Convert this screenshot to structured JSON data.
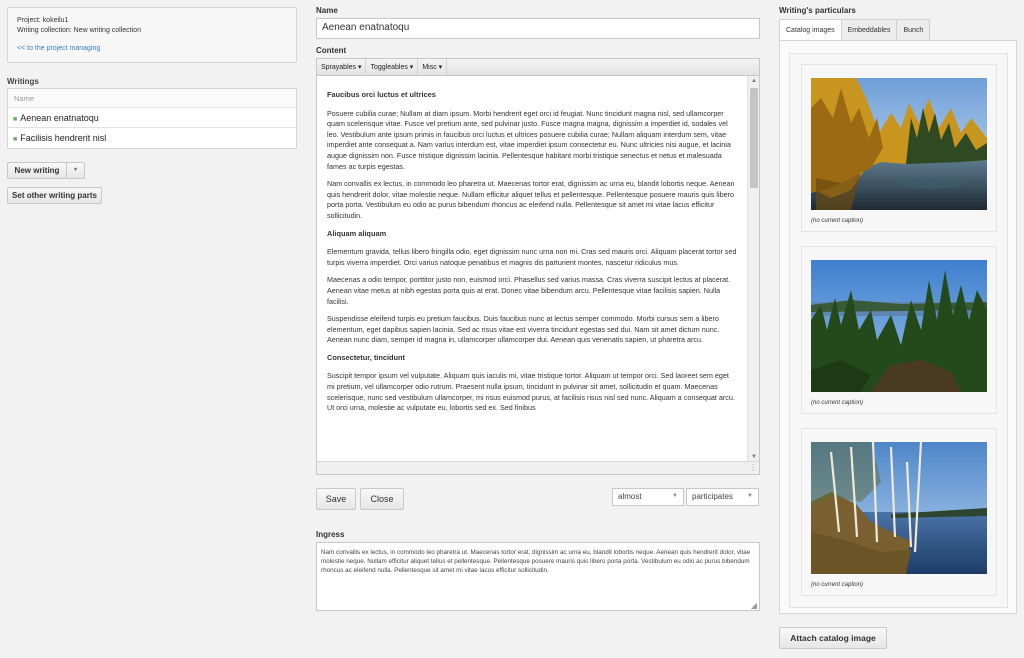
{
  "project": {
    "project_line": "Project: kokeilu1",
    "collection_line": "Writing collection: New writing collection",
    "managing_link": "<< to the project managing"
  },
  "writings": {
    "label": "Writings",
    "column_header": "Name",
    "items": [
      "Aenean enatnatoqu",
      "Facilisis hendrerit nisl"
    ],
    "new_button": "New writing",
    "other_parts_button": "Set other writing parts"
  },
  "editor": {
    "name_label": "Name",
    "name_value": "Aenean enatnatoqu",
    "content_label": "Content",
    "toolbar": [
      "Sprayables ▾",
      "Toggleables ▾",
      "Misc ▾"
    ],
    "blocks": [
      {
        "h": "Faucibus orci luctus et ultrices"
      },
      {
        "p": "Posuere cubilia curae; Nullam at diam ipsum. Morbi hendrerit eget orci id feugiat. Nunc tincidunt magna nisl, sed ullamcorper quam scelerisque vitae. Fusce vel pretium ante, sed pulvinar justo. Fusce magna magna, dignissim a imperdiet id, sodales vel leo. Vestibulum ante ipsum primis in faucibus orci luctus et ultrices posuere cubilia curae; Nullam aliquam interdum sem, vitae imperdiet ante consequat a. Nam varius interdum est, vitae imperdiet ipsum consectetur eu. Nunc ultricies nisi augue, et lacinia augue dignissim non. Fusce tristique dignissim lacinia. Pellentesque habitant morbi tristique senectus et netus et malesuada fames ac turpis egestas."
      },
      {
        "p": "Nam convallis ex lectus, in commodo leo pharetra ut. Maecenas tortor erat, dignissim ac urna eu, blandit lobortis neque. Aenean quis hendrerit dolor, vitae molestie neque. Nullam efficitur aliquet tellus et pellentesque. Pellentesque posuere mauris quis libero porta porta. Vestibulum eu odio ac purus bibendum rhoncus ac eleifend nulla. Pellentesque sit amet mi vitae lacus efficitur sollicitudin."
      },
      {
        "h": "Aliquam aliquam"
      },
      {
        "p": "Elementum gravida, tellus libero fringilla odio, eget dignissim nunc urna non mi. Cras sed mauris orci. Aliquam placerat tortor sed turpis viverra imperdiet. Orci varius natoque penatibus et magnis dis parturient montes, nascetur ridiculus mus."
      },
      {
        "p": "Maecenas a odio tempor, porttitor justo non, euismod orci. Phasellus sed varius massa. Cras viverra suscipit lectus at placerat. Aenean vitae metus at nibh egestas porta quis at erat. Donec vitae bibendum arcu. Pellentesque vitae facilisis sapien. Nulla facilisi."
      },
      {
        "p": "Suspendisse eleifend turpis eu pretium faucibus. Duis faucibus nunc at lectus semper commodo. Morbi cursus sem a libero elementum, eget dapibus sapien lacinia. Sed ac risus vitae est viverra tincidunt egestas sed dui. Nam sit amet dictum nunc. Aenean nunc diam, semper id magna in, ullamcorper ullamcorper dui. Aenean quis venenatis sapien, ut pharetra arcu."
      },
      {
        "h": "Consectetur, tincidunt"
      },
      {
        "p": "Suscipit tempor ipsum vel vulputate. Aliquam quis iaculis mi, vitae tristique tortor. Aliquam ut tempor orci. Sed laoreet sem eget mi pretium, vel ullamcorper odio rutrum. Praesent nulla ipsum, tincidunt in pulvinar sit amet, sollicitudin et quam. Maecenas scelerisque, nunc sed vestibulum ullamcorper, mi risus euismod purus, at facilisis risus nisl sed nunc. Aliquam a consequat arcu. Ut orci urna, molestie ac vulputate eu, lobortis sed ex. Sed finibus"
      }
    ],
    "save_button": "Save",
    "close_button": "Close",
    "select_1": "almost",
    "select_2": "participates",
    "ingress_label": "Ingress",
    "ingress_text": "Nam convallis ex lectus, in commodo leo pharetra ut. Maecenas tortor erat, dignissim ac urna eu, blandit lobortis neque. Aenean quis hendrerit dolor, vitae molestie neque. Nullam efficitur aliquet tellus et pellentesque. Pellentesque posuere mauris quis libero porta porta. Vestibulum eu odio ac purus bibendum rhoncus ac eleifend nulla. Pellentesque sit amet mi vitae lacus efficitur sollicitudin."
  },
  "particulars": {
    "title": "Writing's particulars",
    "tabs": [
      "Catalog images",
      "Embeddables",
      "Bunch"
    ],
    "captions": [
      "(no current caption)",
      "(no current caption)",
      "(no current caption)"
    ],
    "attach_button": "Attach catalog image"
  },
  "colors": {
    "link": "#3a7fc0",
    "bullet": "#66aa66",
    "bg": "#f2f2f2"
  }
}
